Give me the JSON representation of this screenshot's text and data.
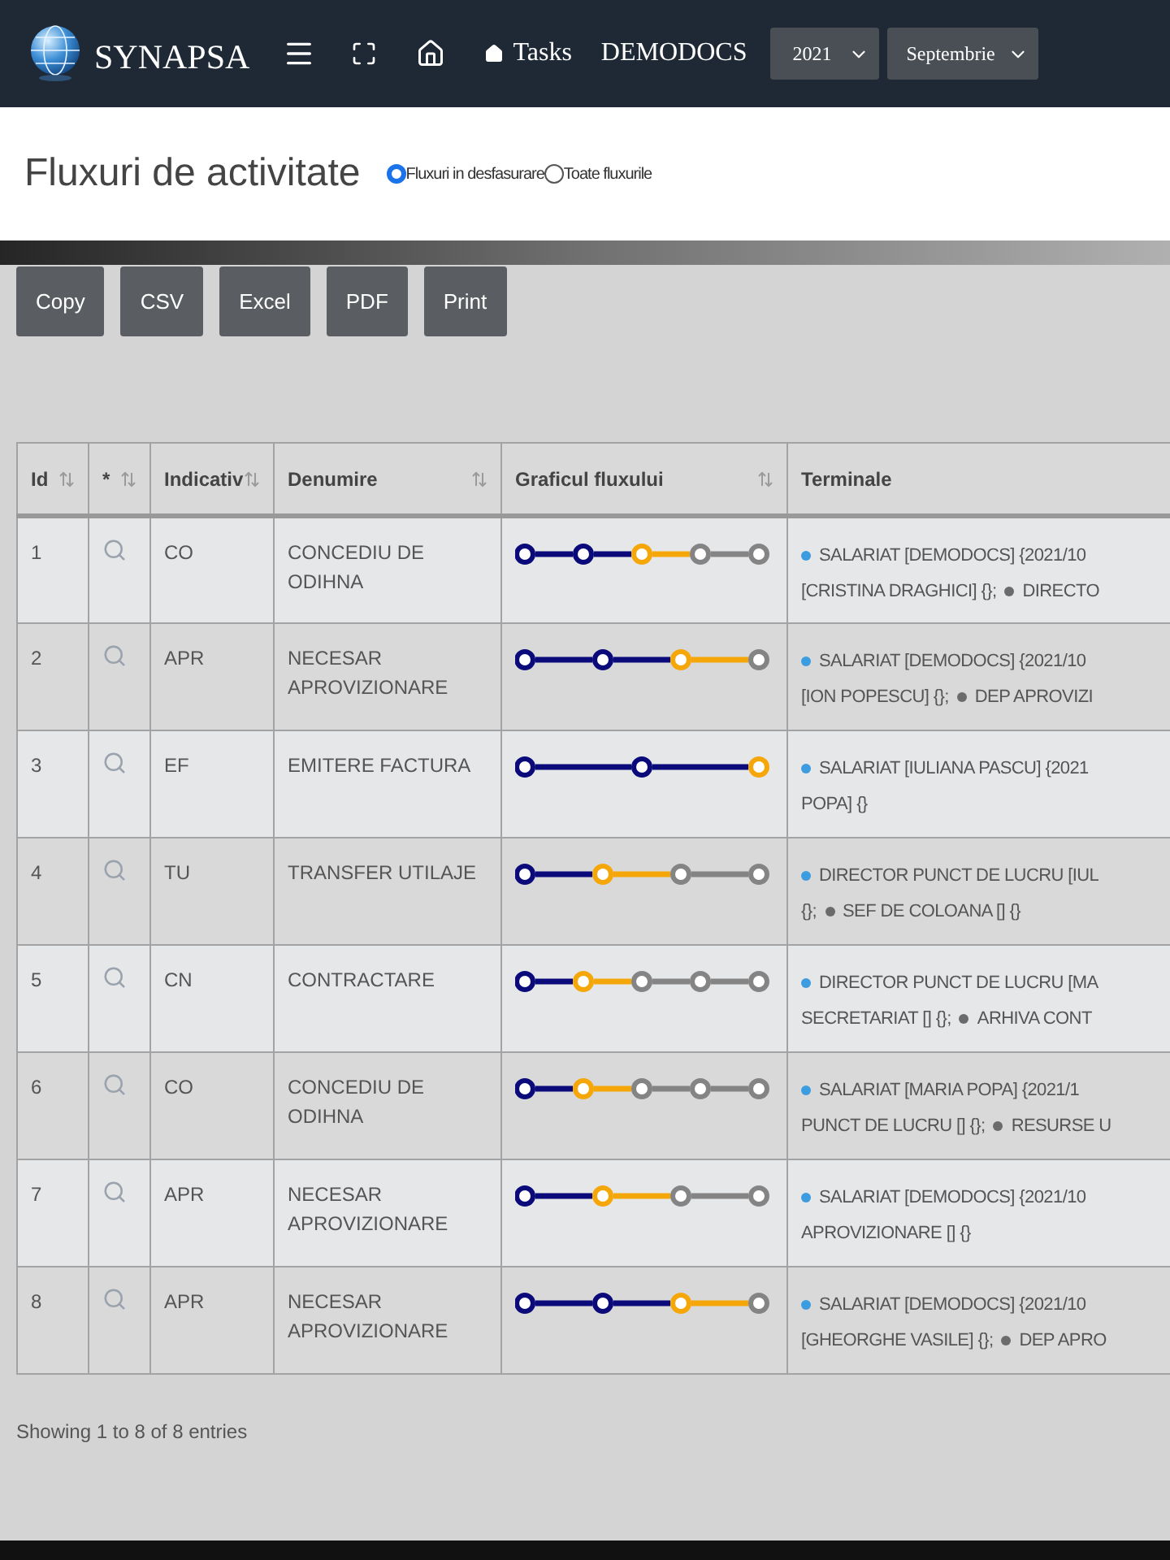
{
  "navbar": {
    "brand": "SYNAPSA",
    "tasks_link": "Tasks",
    "company": "DEMODOCS",
    "year_select": "2021",
    "month_select": "Septembrie"
  },
  "page": {
    "title": "Fluxuri de activitate",
    "filters": [
      {
        "label": "Fluxuri in desfasurare",
        "selected": true
      },
      {
        "label": "Toate fluxurile",
        "selected": false
      }
    ]
  },
  "export_buttons": [
    "Copy",
    "CSV",
    "Excel",
    "PDF",
    "Print"
  ],
  "table": {
    "columns": [
      {
        "label": "Id",
        "sortable": true
      },
      {
        "label": "*",
        "sortable": true
      },
      {
        "label": "Indicativ",
        "sortable": true
      },
      {
        "label": "Denumire",
        "sortable": true
      },
      {
        "label": "Graficul fluxului",
        "sortable": true
      },
      {
        "label": "Terminale",
        "sortable": false
      }
    ],
    "rows": [
      {
        "id": "1",
        "indicativ": "CO",
        "denumire": "CONCEDIU DE ODIHNA",
        "flow": [
          {
            "color": "#0a0a7a"
          },
          {
            "color": "#0a0a7a"
          },
          {
            "color": "#f5a70a"
          },
          {
            "color": "#848484"
          },
          {
            "color": "#848484"
          }
        ],
        "terminals": [
          [
            {
              "color": "#3d9be0",
              "text": "SALARIAT [DEMODOCS] {2021/10"
            }
          ],
          [
            {
              "text": "[CRISTINA DRAGHICI] {};"
            },
            {
              "color": "#6b6b6b",
              "text": "DIRECTO"
            }
          ]
        ]
      },
      {
        "id": "2",
        "indicativ": "APR",
        "denumire": "NECESAR APROVIZIONARE",
        "flow": [
          {
            "color": "#0a0a7a"
          },
          {
            "color": "#0a0a7a"
          },
          {
            "color": "#f5a70a"
          },
          {
            "color": "#848484"
          }
        ],
        "terminals": [
          [
            {
              "color": "#3d9be0",
              "text": "SALARIAT [DEMODOCS] {2021/10"
            }
          ],
          [
            {
              "text": "[ION POPESCU] {};"
            },
            {
              "color": "#6b6b6b",
              "text": "DEP APROVIZI"
            }
          ]
        ]
      },
      {
        "id": "3",
        "indicativ": "EF",
        "denumire": "EMITERE FACTURA",
        "flow": [
          {
            "color": "#0a0a7a"
          },
          {
            "color": "#0a0a7a"
          },
          {
            "color": "#f5a70a"
          }
        ],
        "terminals": [
          [
            {
              "color": "#3d9be0",
              "text": "SALARIAT [IULIANA PASCU] {2021"
            }
          ],
          [
            {
              "text": "POPA] {}"
            }
          ]
        ]
      },
      {
        "id": "4",
        "indicativ": "TU",
        "denumire": "TRANSFER UTILAJE",
        "flow": [
          {
            "color": "#0a0a7a"
          },
          {
            "color": "#f5a70a"
          },
          {
            "color": "#848484"
          },
          {
            "color": "#848484"
          }
        ],
        "terminals": [
          [
            {
              "color": "#3d9be0",
              "text": "DIRECTOR PUNCT DE LUCRU [IUL"
            }
          ],
          [
            {
              "text": "{};"
            },
            {
              "color": "#6b6b6b",
              "text": "SEF DE COLOANA [] {}"
            }
          ]
        ]
      },
      {
        "id": "5",
        "indicativ": "CN",
        "denumire": "CONTRACTARE",
        "flow": [
          {
            "color": "#0a0a7a"
          },
          {
            "color": "#f5a70a"
          },
          {
            "color": "#848484"
          },
          {
            "color": "#848484"
          },
          {
            "color": "#848484"
          }
        ],
        "terminals": [
          [
            {
              "color": "#3d9be0",
              "text": "DIRECTOR PUNCT DE LUCRU [MA"
            }
          ],
          [
            {
              "text": "SECRETARIAT [] {};"
            },
            {
              "color": "#6b6b6b",
              "text": "ARHIVA CONT"
            }
          ]
        ]
      },
      {
        "id": "6",
        "indicativ": "CO",
        "denumire": "CONCEDIU DE ODIHNA",
        "flow": [
          {
            "color": "#0a0a7a"
          },
          {
            "color": "#f5a70a"
          },
          {
            "color": "#848484"
          },
          {
            "color": "#848484"
          },
          {
            "color": "#848484"
          }
        ],
        "terminals": [
          [
            {
              "color": "#3d9be0",
              "text": "SALARIAT [MARIA POPA] {2021/1"
            }
          ],
          [
            {
              "text": "PUNCT DE LUCRU [] {};"
            },
            {
              "color": "#6b6b6b",
              "text": "RESURSE U"
            }
          ]
        ]
      },
      {
        "id": "7",
        "indicativ": "APR",
        "denumire": "NECESAR APROVIZIONARE",
        "flow": [
          {
            "color": "#0a0a7a"
          },
          {
            "color": "#f5a70a"
          },
          {
            "color": "#848484"
          },
          {
            "color": "#848484"
          }
        ],
        "terminals": [
          [
            {
              "color": "#3d9be0",
              "text": "SALARIAT [DEMODOCS] {2021/10"
            }
          ],
          [
            {
              "text": "APROVIZIONARE [] {}"
            }
          ]
        ]
      },
      {
        "id": "8",
        "indicativ": "APR",
        "denumire": "NECESAR APROVIZIONARE",
        "flow": [
          {
            "color": "#0a0a7a"
          },
          {
            "color": "#0a0a7a"
          },
          {
            "color": "#f5a70a"
          },
          {
            "color": "#848484"
          }
        ],
        "terminals": [
          [
            {
              "color": "#3d9be0",
              "text": "SALARIAT [DEMODOCS] {2021/10"
            }
          ],
          [
            {
              "text": "[GHEORGHE VASILE] {};"
            },
            {
              "color": "#6b6b6b",
              "text": "DEP APRO"
            }
          ]
        ]
      }
    ]
  },
  "info": "Showing 1 to 8 of 8 entries"
}
